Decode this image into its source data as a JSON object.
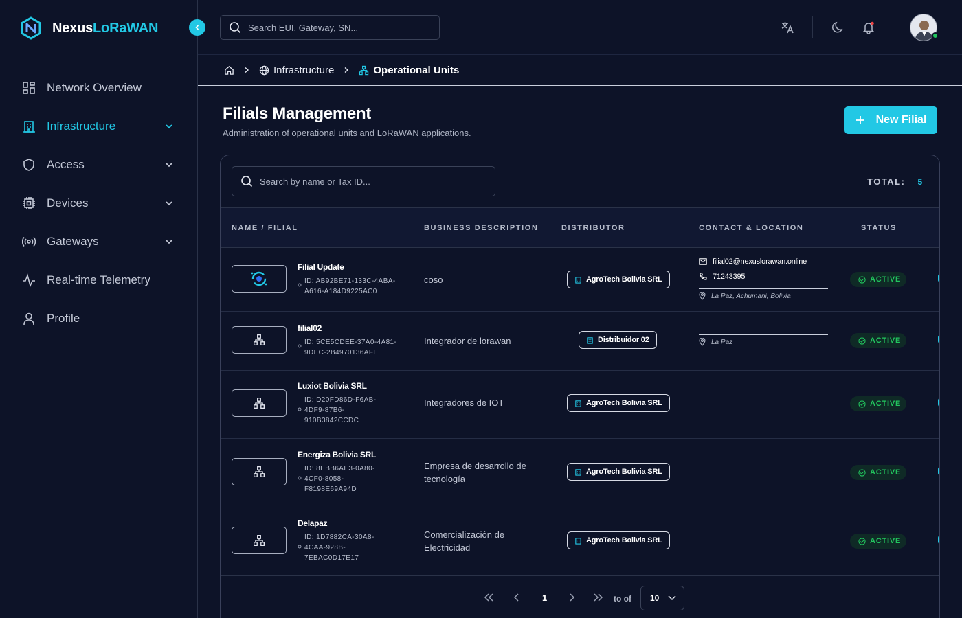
{
  "app": {
    "brand_part1": "Nexus",
    "brand_part2": "LoRaWAN",
    "accent": "#22c8e5"
  },
  "sidebar": {
    "items": [
      {
        "label": "Network Overview",
        "icon": "grid-icon"
      },
      {
        "label": "Infrastructure",
        "icon": "building-icon",
        "active": true
      },
      {
        "label": "Access",
        "icon": "shield-icon"
      },
      {
        "label": "Devices",
        "icon": "chip-icon"
      },
      {
        "label": "Gateways",
        "icon": "signal-icon"
      },
      {
        "label": "Real-time Telemetry",
        "icon": "pulse-icon"
      },
      {
        "label": "Profile",
        "icon": "user-icon"
      }
    ]
  },
  "topbar": {
    "search_placeholder": "Search EUI, Gateway, SN..."
  },
  "breadcrumb": {
    "level1": "Infrastructure",
    "level2": "Operational Units"
  },
  "page": {
    "title": "Filials Management",
    "subtitle": "Administration of operational units and LoRaWAN applications.",
    "new_button": "New Filial"
  },
  "table": {
    "search_placeholder": "Search by name or Tax ID...",
    "total_label": "TOTAL:",
    "total_value": "5",
    "headers": {
      "name": "NAME / FILIAL",
      "desc": "BUSINESS DESCRIPTION",
      "distributor": "DISTRIBUTOR",
      "contact": "CONTACT & LOCATION",
      "status": "STATUS"
    },
    "rows": [
      {
        "name": "Filial Update",
        "id_lines": [
          "ID: AB92BE71-133C-4ABA-",
          "A616-A184D9225AC0"
        ],
        "desc": "coso",
        "distributor": "AgroTech Bolivia SRL",
        "email": "filial02@nexuslorawan.online",
        "phone": "71243395",
        "location": "La Paz, Achumani, Bolivia",
        "status": "ACTIVE"
      },
      {
        "name": "filial02",
        "id_lines": [
          "ID: 5CE5CDEE-37A0-4A81-",
          "9DEC-2B4970136AFE"
        ],
        "desc": "Integrador de lorawan",
        "distributor": "Distribuidor 02",
        "location": "La Paz",
        "status": "ACTIVE"
      },
      {
        "name": "Luxiot Bolivia SRL",
        "id_lines": [
          "ID: D20FD86D-F6AB-",
          "4DF9-87B6-",
          "910B3842CCDC"
        ],
        "desc": "Integradores de IOT",
        "distributor": "AgroTech Bolivia SRL",
        "status": "ACTIVE"
      },
      {
        "name": "Energiza Bolivia SRL",
        "id_lines": [
          "ID: 8EBB6AE3-0A80-",
          "4CF0-8058-",
          "F8198E69A94D"
        ],
        "desc_lines": [
          "Empresa de desarrollo de",
          "tecnología"
        ],
        "distributor": "AgroTech Bolivia SRL",
        "status": "ACTIVE"
      },
      {
        "name": "Delapaz",
        "id_lines": [
          "ID: 1D7882CA-30A8-",
          "4CAA-928B-",
          "7EBAC0D17E17"
        ],
        "desc_lines": [
          "Comercialización de",
          "Electricidad"
        ],
        "distributor": "AgroTech Bolivia SRL",
        "status": "ACTIVE"
      }
    ]
  },
  "pagination": {
    "current": "1",
    "label": "to of",
    "page_size": "10"
  }
}
